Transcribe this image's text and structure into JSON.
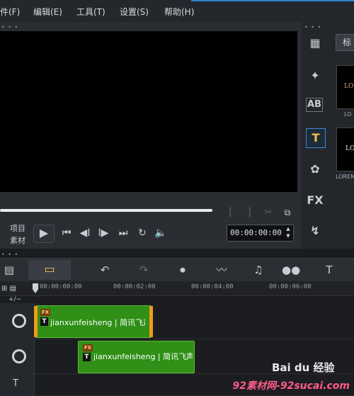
{
  "menu": {
    "file": "件(F)",
    "edit": "编辑(E)",
    "tools": "工具(T)",
    "settings": "设置(S)",
    "help": "帮助(H)"
  },
  "preview": {
    "mode_project": "项目",
    "mode_clip": "素材",
    "timecode": "00:00:00:00",
    "trim_start": "[",
    "trim_end": "]"
  },
  "library": {
    "tab_label": "标",
    "thumb1_word": "LO",
    "thumb1_caption": "LO",
    "thumb2_word": "LO",
    "thumb2_caption": "LOREMI",
    "fx_label": "FX"
  },
  "timeline": {
    "ticks": [
      "00:00:00:00",
      "00:00:02:00",
      "00:00:04:00",
      "00:00:06:00"
    ],
    "controls": "+/−",
    "clips": [
      {
        "fx": "FX",
        "type": "T",
        "text": "jianxunfeisheng | 简讯飞声"
      },
      {
        "fx": "FX",
        "type": "T",
        "text": "jianxunfeisheng | 简讯飞声"
      }
    ]
  },
  "watermark": {
    "baidu": "Bai du 经验",
    "site": "92素材网-92sucai.com"
  }
}
